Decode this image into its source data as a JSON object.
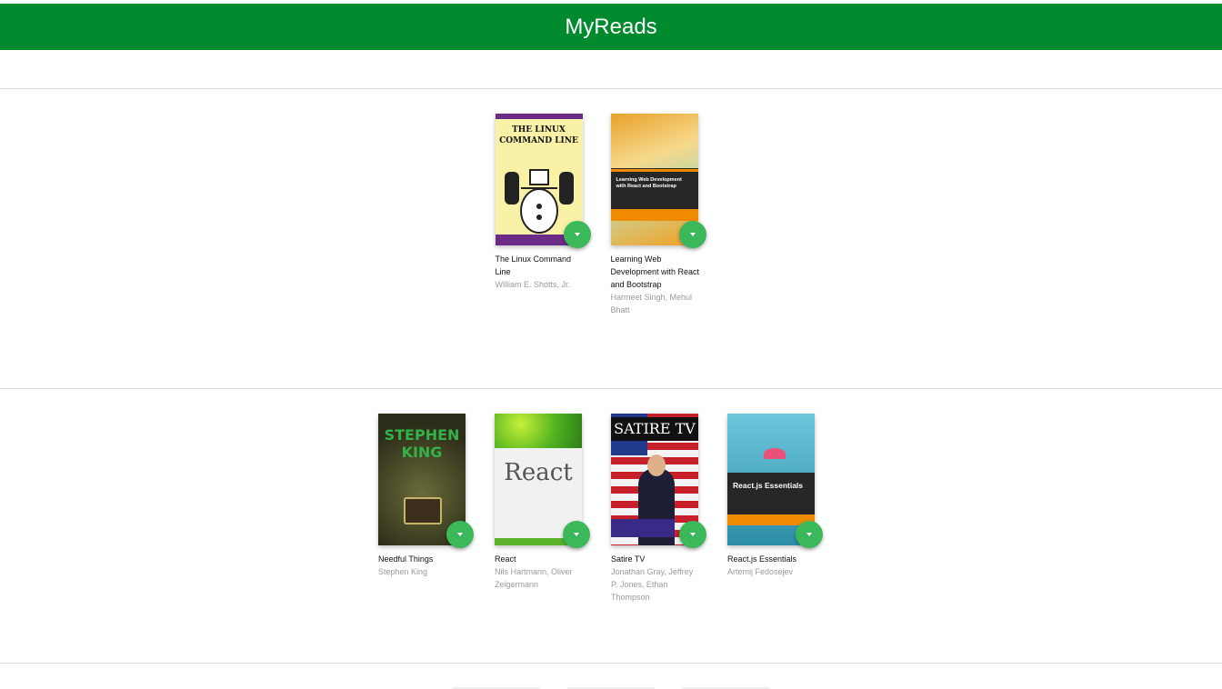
{
  "app": {
    "title": "MyReads",
    "header_color": "#008a2e"
  },
  "shelves": [
    {
      "books": [
        {
          "title": "The Linux Command Line",
          "authors": "William E. Shotts, Jr.",
          "cover_text": "THE LINUX COMMAND LINE"
        },
        {
          "title": "Learning Web Development with React and Bootstrap",
          "authors": "Harmeet Singh, Mehul Bhatt",
          "cover_text": "Learning Web Development with React and Bootstrap"
        }
      ]
    },
    {
      "books": [
        {
          "title": "Needful Things",
          "authors": "Stephen King",
          "cover_text": "STEPHEN KING"
        },
        {
          "title": "React",
          "authors": "Nils Hartmann, Oliver Zeigermann",
          "cover_text": "React"
        },
        {
          "title": "Satire TV",
          "authors": "Jonathan Gray, Jeffrey P. Jones, Ethan Thompson",
          "cover_text": "SATIRE TV"
        },
        {
          "title": "React.js Essentials",
          "authors": "Artemij Fedosejev",
          "cover_text": "React.js Essentials"
        }
      ]
    }
  ],
  "icons": {
    "shelf_changer": "chevron-down-icon"
  },
  "accent": "#3bb95a"
}
